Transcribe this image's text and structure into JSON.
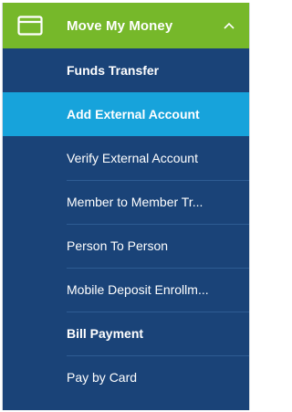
{
  "header": {
    "title": "Move My Money",
    "icon": "credit-card-icon",
    "toggle_icon": "chevron-up-icon"
  },
  "items": [
    {
      "label": "Funds Transfer",
      "active": false,
      "bold": true
    },
    {
      "label": "Add External Account",
      "active": true,
      "bold": true
    },
    {
      "label": "Verify External Account",
      "active": false,
      "bold": false
    },
    {
      "label": "Member to Member Tr...",
      "active": false,
      "bold": false
    },
    {
      "label": "Person To Person",
      "active": false,
      "bold": false
    },
    {
      "label": "Mobile Deposit Enrollm...",
      "active": false,
      "bold": false
    },
    {
      "label": "Bill Payment",
      "active": false,
      "bold": true
    },
    {
      "label": "Pay by Card",
      "active": false,
      "bold": false
    }
  ],
  "colors": {
    "header": "#76b82a",
    "menu_bg": "#1a4378",
    "active_bg": "#17a3db",
    "text": "#ffffff"
  }
}
